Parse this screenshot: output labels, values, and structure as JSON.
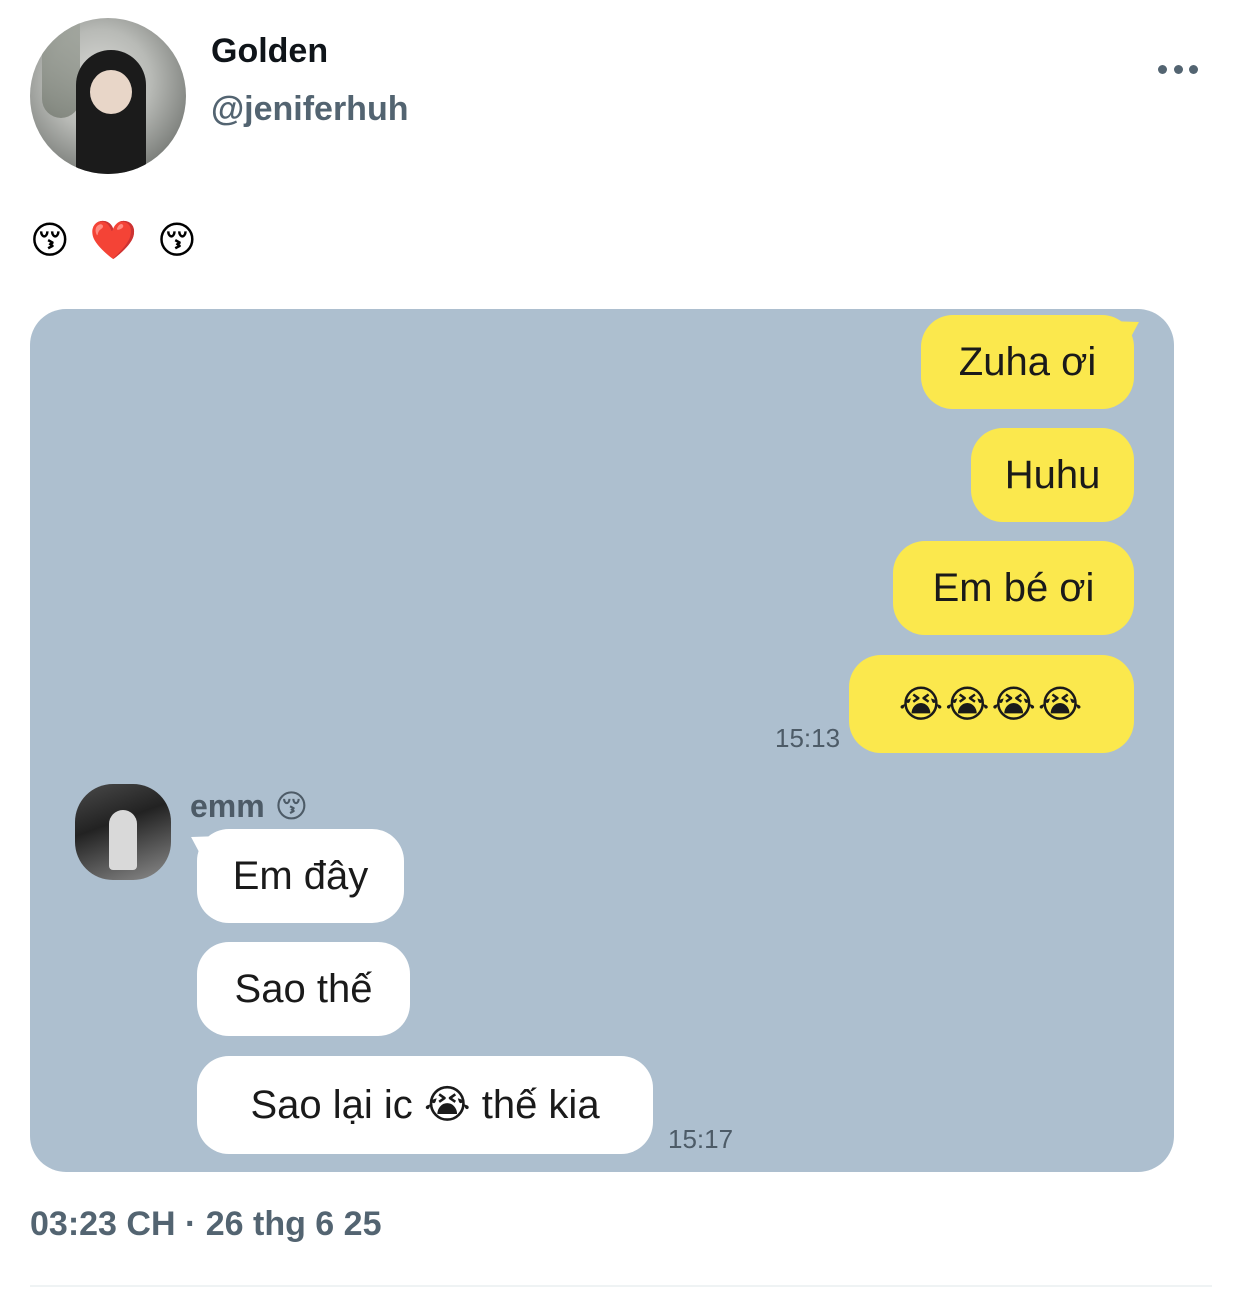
{
  "tweet": {
    "display_name": "Golden",
    "handle": "@jeniferhuh",
    "text": "😚 ❤️ 😚",
    "timestamp": "03:23 CH · 26 thg 6 25"
  },
  "chat": {
    "outgoing": [
      {
        "text": "Zuha ơi"
      },
      {
        "text": "Huhu"
      },
      {
        "text": "Em bé ơi"
      },
      {
        "text": "😭😭😭😭"
      }
    ],
    "outgoing_time": "15:13",
    "friend_name": "emm",
    "friend_name_emoji": "😚",
    "incoming": [
      {
        "text": "Em đây"
      },
      {
        "text": "Sao thế"
      },
      {
        "text": "Sao lại ic 😭 thế kia"
      }
    ],
    "incoming_time": "15:17"
  },
  "colors": {
    "chat_background": "#adbfcf",
    "outgoing_bubble": "#fbe84d",
    "incoming_bubble": "#ffffff",
    "secondary_text": "#536471"
  }
}
